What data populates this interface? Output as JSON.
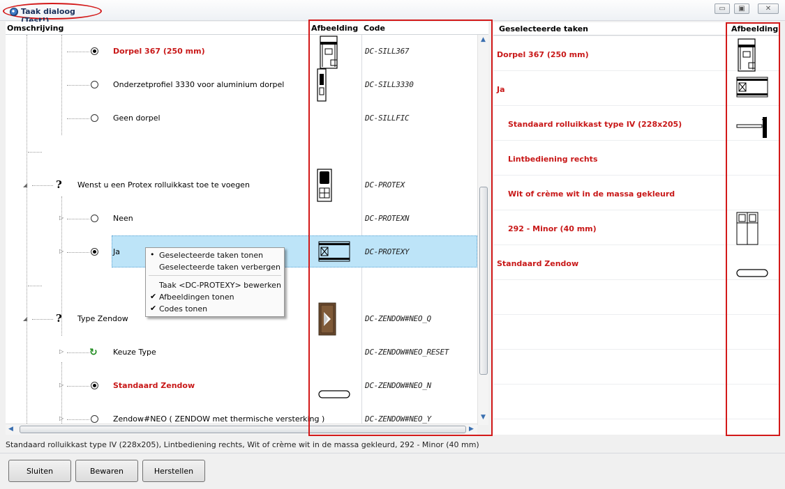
{
  "window": {
    "title": "Taak dialoog (Test!)",
    "minimize_glyph": "▭",
    "restore_glyph": "▣",
    "close_glyph": "✕"
  },
  "tree": {
    "headers": {
      "description": "Omschrijving",
      "image": "Afbeelding",
      "code": "Code"
    },
    "rows": [
      {
        "label": "Dorpel 367 (250 mm)",
        "code": "DC-SILL367",
        "red": true,
        "marker": "radio-on",
        "image": "sill-367-icon"
      },
      {
        "label": "Onderzetprofiel 3330 voor aluminium dorpel",
        "code": "DC-SILL3330",
        "red": false,
        "marker": "radio-off",
        "image": "sill-3330-icon"
      },
      {
        "label": "Geen dorpel",
        "code": "DC-SILLFIC",
        "red": false,
        "marker": "radio-off",
        "image": ""
      },
      {
        "label": "",
        "code": "",
        "red": false,
        "marker": "none",
        "image": ""
      },
      {
        "label": "Wenst u een Protex rolluikkast toe te voegen",
        "code": "DC-PROTEX",
        "red": false,
        "marker": "question",
        "image": "protex-icon"
      },
      {
        "label": "Neen",
        "code": "DC-PROTEXN",
        "red": false,
        "marker": "radio-off",
        "image": ""
      },
      {
        "label": "Ja",
        "code": "DC-PROTEXY",
        "red": false,
        "marker": "radio-on",
        "image": "protex-yes-icon",
        "selected": true
      },
      {
        "label": "",
        "code": "",
        "red": false,
        "marker": "none",
        "image": ""
      },
      {
        "label": "Type Zendow",
        "code": "DC-ZENDOW#NEO_Q",
        "red": false,
        "marker": "question",
        "image": "zendow-icon"
      },
      {
        "label": "Keuze Type",
        "code": "DC-ZENDOW#NEO_RESET",
        "red": false,
        "marker": "reset",
        "image": ""
      },
      {
        "label": "Standaard Zendow",
        "code": "DC-ZENDOW#NEO_N",
        "red": true,
        "marker": "radio-on",
        "image": "zendow-standard-icon"
      },
      {
        "label": "Zendow#NEO ( ZENDOW met thermische versterking )",
        "code": "DC-ZENDOW#NEO_Y",
        "red": false,
        "marker": "radio-off",
        "image": ""
      }
    ]
  },
  "context_menu": {
    "items": [
      {
        "label": "Geselecteerde taken tonen",
        "mark": "•"
      },
      {
        "label": "Geselecteerde taken verbergen",
        "mark": ""
      },
      {
        "label": "Taak <DC-PROTEXY> bewerken",
        "mark": ""
      },
      {
        "label": "Afbeeldingen tonen",
        "mark": "✔"
      },
      {
        "label": "Codes tonen",
        "mark": "✔"
      }
    ]
  },
  "selected_panel": {
    "headers": {
      "tasks": "Geselecteerde taken",
      "image": "Afbeelding"
    },
    "rows": [
      {
        "label": "Dorpel 367 (250 mm)",
        "indent": false,
        "image": "sill-367-icon"
      },
      {
        "label": "Ja",
        "indent": false,
        "image": "protex-yes-icon"
      },
      {
        "label": "Standaard rolluikkast type IV (228x205)",
        "indent": true,
        "image": "roller-box-icon"
      },
      {
        "label": "Lintbediening rechts",
        "indent": true,
        "image": ""
      },
      {
        "label": "Wit of crème wit in de massa gekleurd",
        "indent": true,
        "image": ""
      },
      {
        "label": "292 - Minor (40 mm)",
        "indent": true,
        "image": "minor-icon"
      },
      {
        "label": "Standaard Zendow",
        "indent": false,
        "image": "zendow-standard-icon"
      },
      {
        "label": "",
        "indent": false,
        "image": ""
      },
      {
        "label": "",
        "indent": false,
        "image": ""
      },
      {
        "label": "",
        "indent": false,
        "image": ""
      },
      {
        "label": "",
        "indent": false,
        "image": ""
      }
    ]
  },
  "status": "Standaard rolluikkast type IV (228x205), Lintbediening rechts, Wit of crème wit in de massa gekleurd, 292 - Minor (40 mm)",
  "buttons": {
    "close": "Sluiten",
    "save": "Bewaren",
    "restore": "Herstellen"
  },
  "colors": {
    "highlight_red": "#c81818",
    "selection_blue": "#bde4f8",
    "annotation_red": "#d31919"
  }
}
